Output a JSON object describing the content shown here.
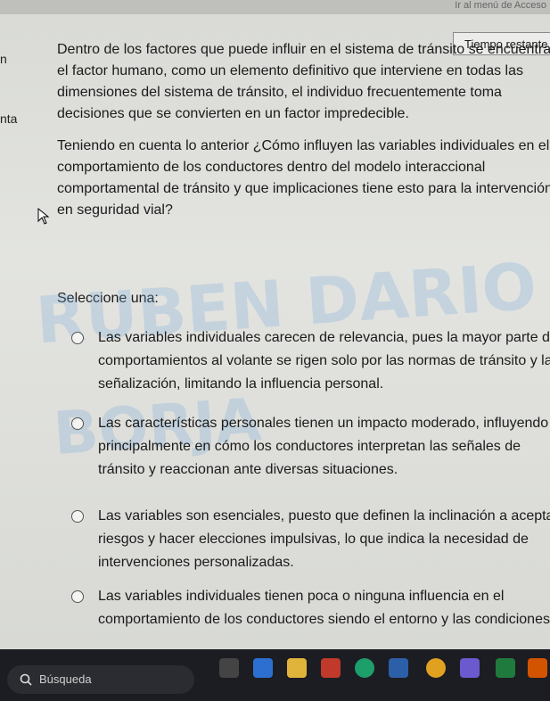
{
  "header": {
    "menu_access": "Ir al menú de Acceso"
  },
  "timer": {
    "label": "Tiempo restante"
  },
  "left_gutter": {
    "letter_top": "n",
    "letter_bottom": "nta"
  },
  "question": {
    "paragraph1": "Dentro de los factores que puede influir en el sistema de tránsito se encuentra el factor humano, como un elemento definitivo que interviene en todas las dimensiones del sistema de tránsito, el individuo frecuentemente toma decisiones que se convierten en un factor impredecible.",
    "paragraph2": "Teniendo en cuenta lo anterior ¿Cómo influyen las variables individuales en el comportamiento de los conductores dentro del modelo interaccional comportamental de tránsito y que implicaciones tiene esto para la intervención en seguridad vial?",
    "select_label": "Seleccione una:"
  },
  "watermark": {
    "line1": "RUBEN DARIO",
    "line2": "BORJA"
  },
  "options": [
    {
      "text": "Las variables individuales carecen de relevancia, pues la mayor parte del comportamientos al volante se rigen solo por las normas de tránsito y la señalización, limitando la influencia personal."
    },
    {
      "text": "Las características personales tienen un impacto moderado, influyendo principalmente en cómo los conductores interpretan las señales de tránsito y reaccionan ante diversas situaciones."
    },
    {
      "text": "Las variables son esenciales, puesto que definen la inclinación a aceptar riesgos y hacer elecciones impulsivas, lo que indica la necesidad de intervenciones personalizadas."
    },
    {
      "text": "Las variables individuales tienen poca o ninguna influencia en el comportamiento de los conductores siendo el entorno y las condiciones"
    }
  ],
  "taskbar": {
    "search_placeholder": "Búsqueda"
  },
  "colors": {
    "page_bg": "#dcddd9",
    "taskbar_bg": "#1c1d22",
    "watermark": "#78aadc"
  }
}
